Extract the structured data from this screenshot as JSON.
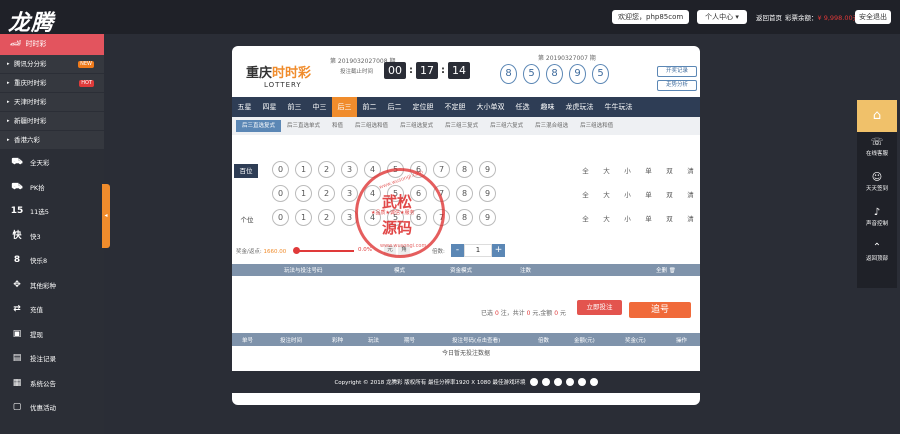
{
  "header": {
    "logo": "龙腾",
    "welcome": "欢迎您，php85com",
    "user_center": "个人中心",
    "home_link": "返回首页",
    "balance_label": "彩票余额：",
    "balance_value": "¥ 9,998.00元",
    "logout": "安全退出"
  },
  "sidebar": {
    "main_label": "时时彩",
    "sub_items": [
      {
        "label": "腾讯分分彩",
        "tag": "NEW"
      },
      {
        "label": "重庆时时彩",
        "tag": "HOT"
      },
      {
        "label": "天津时时彩",
        "tag": ""
      },
      {
        "label": "新疆时时彩",
        "tag": ""
      },
      {
        "label": "香港六彩",
        "tag": ""
      }
    ],
    "nav_items": [
      {
        "label": "全天彩",
        "icon": "car-icon"
      },
      {
        "label": "PK拾",
        "icon": "race-car-icon"
      },
      {
        "label": "11选5",
        "icon": "11x5-icon"
      },
      {
        "label": "快3",
        "icon": "k3-icon"
      },
      {
        "label": "快乐8",
        "icon": "kl8-icon"
      },
      {
        "label": "其他彩种",
        "icon": "gamepad-icon"
      },
      {
        "label": "充值",
        "icon": "recharge-icon"
      },
      {
        "label": "提现",
        "icon": "withdraw-icon"
      },
      {
        "label": "投注记录",
        "icon": "record-icon"
      },
      {
        "label": "系统公告",
        "icon": "notice-icon"
      },
      {
        "label": "优惠活动",
        "icon": "promo-icon"
      }
    ]
  },
  "lottery": {
    "name_prefix": "重庆",
    "name_highlight": "时时彩",
    "subtitle": "LOTTERY",
    "current_period": "第 2019032027008 期",
    "countdown_label": "投注截止时间",
    "timer": [
      "00",
      "17",
      "14"
    ],
    "last_period": "第 20190327007 期",
    "last_numbers": [
      "8",
      "5",
      "8",
      "9",
      "5"
    ],
    "btn_open_record": "开奖记录",
    "btn_trend": "走势分析"
  },
  "tabs": [
    "五星",
    "四星",
    "前三",
    "中三",
    "后三",
    "前二",
    "后二",
    "定位胆",
    "不定胆",
    "大小单双",
    "任选",
    "趣味",
    "龙虎玩法",
    "牛牛玩法"
  ],
  "active_tab": 4,
  "subtabs": [
    "后三直选复式",
    "后三直选单式",
    "和值",
    "后三组选和值",
    "后三组选复式",
    "后三组三复式",
    "后三组六复式",
    "后三混合组选",
    "后三组选和值"
  ],
  "rows": [
    {
      "label": "百位",
      "dark": true
    },
    {
      "label": "",
      "dark": false
    },
    {
      "label": "个位",
      "dark": false
    }
  ],
  "numbers": [
    "0",
    "1",
    "2",
    "3",
    "4",
    "5",
    "6",
    "7",
    "8",
    "9"
  ],
  "quick": [
    "全",
    "大",
    "小",
    "单",
    "双",
    "清"
  ],
  "controls": {
    "rebate_label": "奖金/返点:",
    "rebate_value": "1660.00",
    "rebate_pct": "0.0%",
    "modes": [
      "元",
      "角"
    ],
    "multiplier_label": "倍数:",
    "multiplier": "1"
  },
  "bet_list_headers": [
    "玩法与投注号码",
    "模式",
    "资金模式",
    "注数",
    "全删"
  ],
  "summary": {
    "prefix": "已选",
    "count": "0",
    "unit": "注，共计",
    "amount": "0",
    "suffix": "元,金额",
    "total": "0",
    "end": "元"
  },
  "btn_instant": "立即投注",
  "btn_chase": "追号",
  "record_headers": [
    "单号",
    "投注时间",
    "彩种",
    "玩法",
    "期号",
    "投注号码(点击查看)",
    "倍数",
    "金额(元)",
    "奖金(元)",
    "操作"
  ],
  "record_empty": "今日暂无投注数据",
  "footer": "Copyright © 2018 龙腾彩 版权所有 最佳分辨率1920 X 1080 最佳游戏环境",
  "right_bar": [
    "在线客服",
    "天天签到",
    "声音控制",
    "返回顶部"
  ],
  "stamp": {
    "top": "www.wusongi.com",
    "main1": "武松",
    "mid": "★品质★诚信★服务",
    "main2": "源码",
    "bottom": "www.wusongi.com"
  },
  "colors": {
    "accent": "#f08c2c",
    "sidebar_active": "#e3545e",
    "tab_bar": "#2e3d55",
    "ball_border": "#5b87b5"
  }
}
